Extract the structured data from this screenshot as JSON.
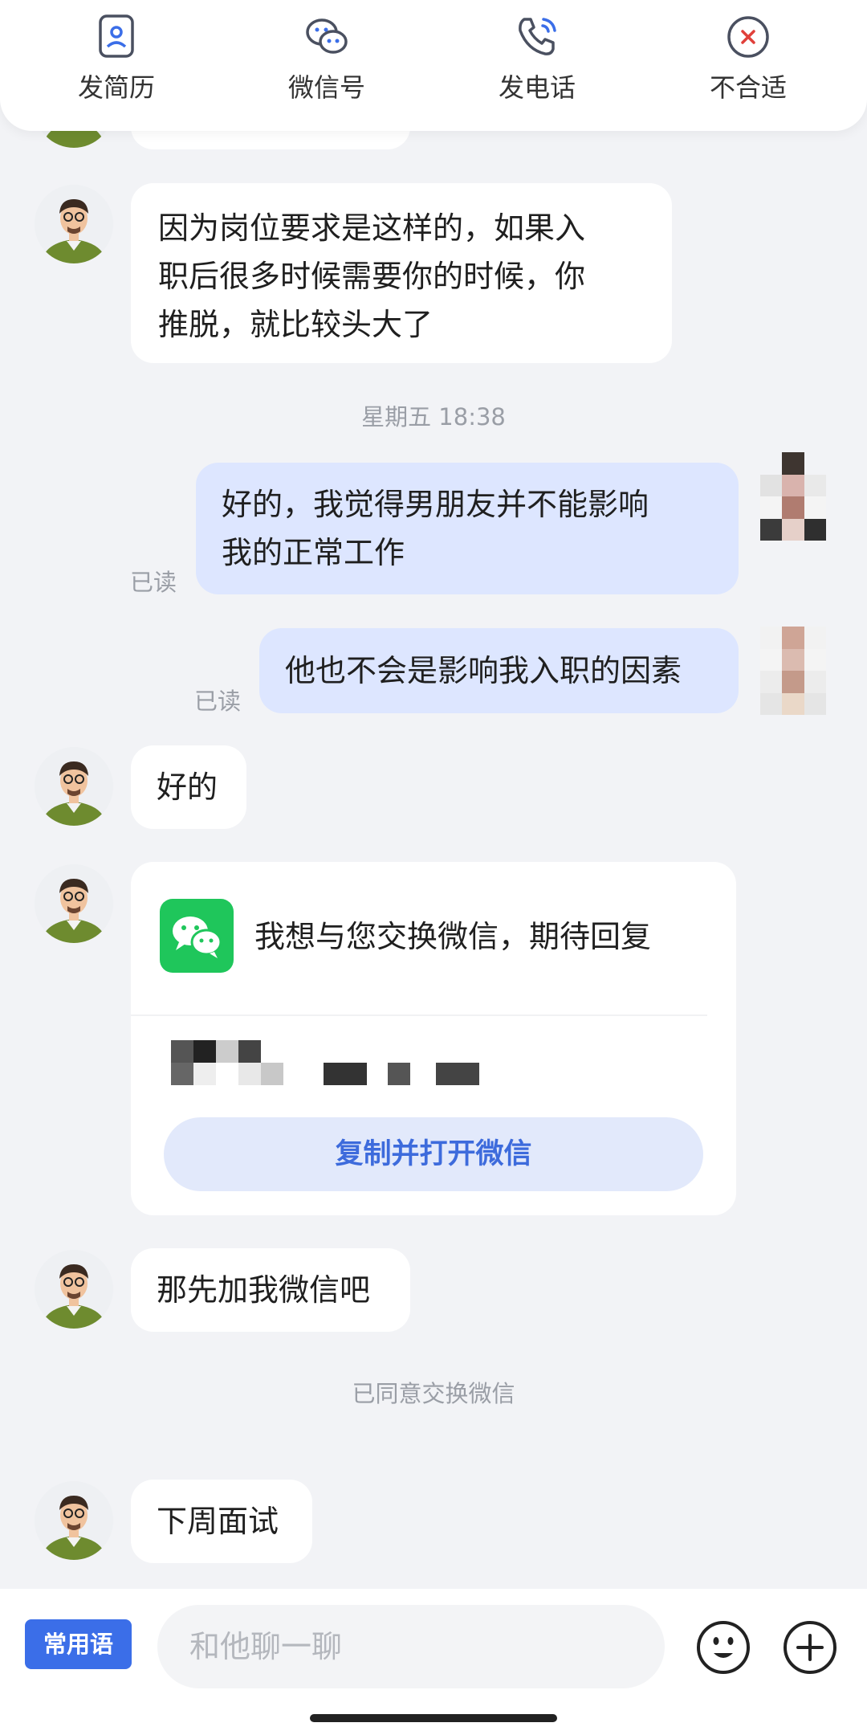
{
  "actions": [
    {
      "label": "发简历",
      "icon": "resume-icon"
    },
    {
      "label": "微信号",
      "icon": "wechat-icon"
    },
    {
      "label": "发电话",
      "icon": "phone-icon"
    },
    {
      "label": "不合适",
      "icon": "close-circle-icon"
    }
  ],
  "messages": {
    "m1": {
      "lines": [
        "因为岗位要求是这样的，如果入",
        "职后很多时候需要你的时候，你",
        "推脱，就比较头大了"
      ]
    },
    "time1": "星期五 18:38",
    "m2": {
      "lines": [
        "好的，我觉得男朋友并不能影响",
        "我的正常工作"
      ],
      "status": "已读"
    },
    "m3": {
      "text": "他也不会是影响我入职的因素",
      "status": "已读"
    },
    "m4": {
      "text": "好的"
    },
    "wechat_card": {
      "text": "我想与您交换微信，期待回复",
      "button": "复制并打开微信"
    },
    "m5": {
      "text": "那先加我微信吧"
    },
    "notice": "已同意交换微信",
    "m6": {
      "text": "下周面试"
    }
  },
  "input_bar": {
    "phrases_button": "常用语",
    "placeholder": "和他聊一聊",
    "emoji_icon": "emoji-icon",
    "plus_icon": "plus-icon"
  },
  "colors": {
    "accent": "#3b6ee8",
    "outgoing_bubble": "#dde6ff",
    "wechat_green": "#1fc65b"
  }
}
